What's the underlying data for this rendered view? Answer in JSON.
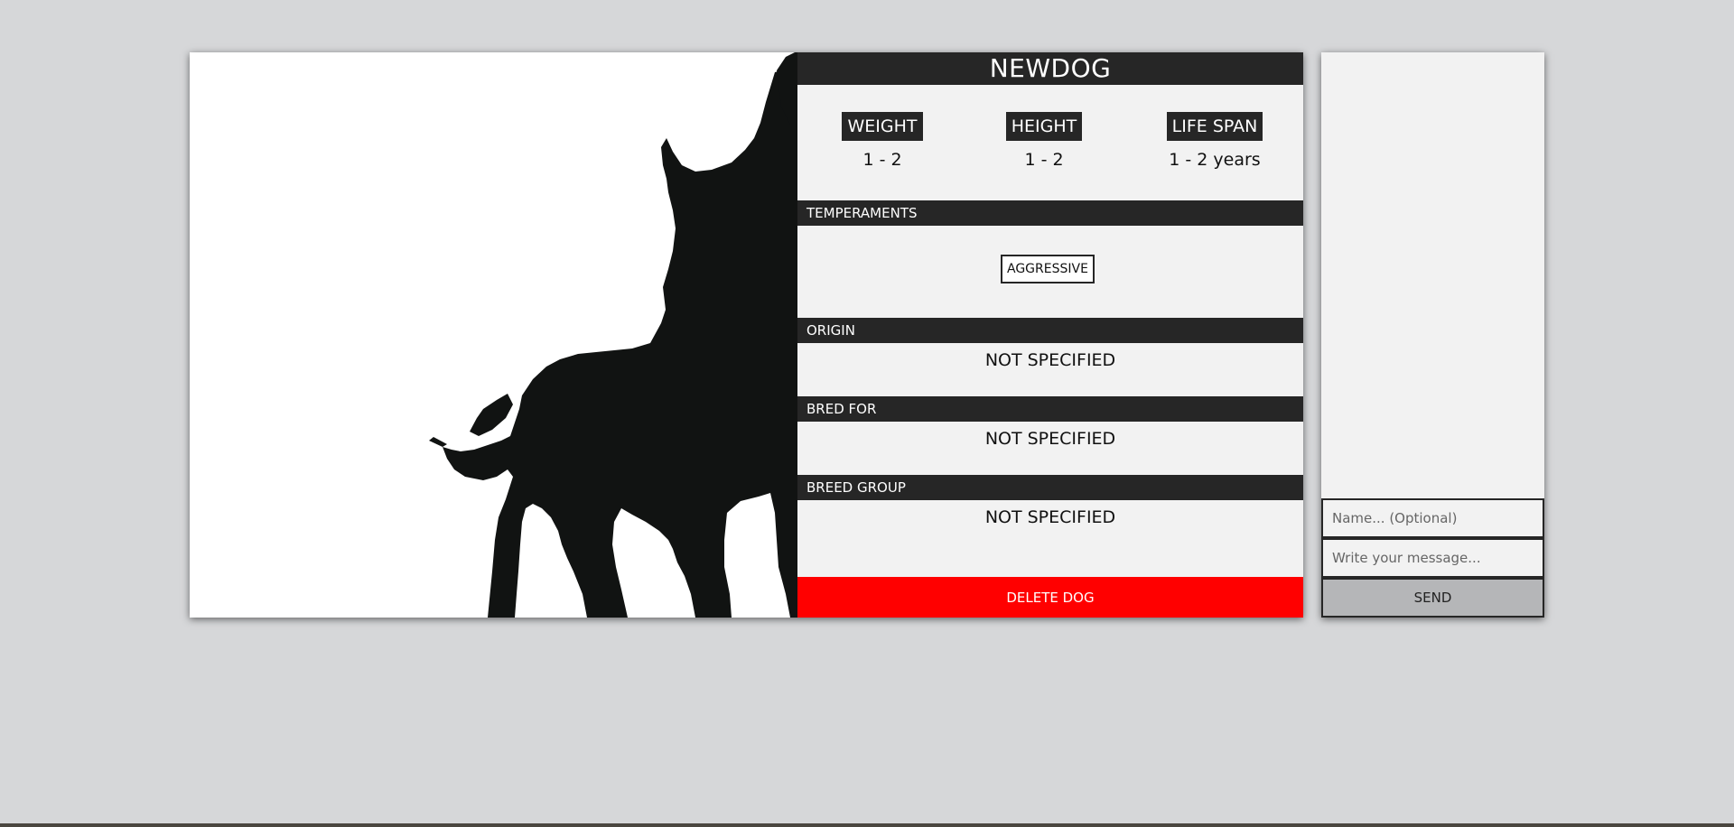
{
  "dog": {
    "name": "NEWDOG",
    "image_icon": "dog-silhouette",
    "stats": [
      {
        "label": "WEIGHT",
        "value": "1 - 2"
      },
      {
        "label": "HEIGHT",
        "value": "1 - 2"
      },
      {
        "label": "LIFE SPAN",
        "value": "1 - 2 years"
      }
    ],
    "temperaments_label": "TEMPERAMENTS",
    "temperaments": [
      "AGGRESSIVE"
    ],
    "origin_label": "ORIGIN",
    "origin_value": "NOT SPECIFIED",
    "bred_for_label": "BRED FOR",
    "bred_for_value": "NOT SPECIFIED",
    "breed_group_label": "BREED GROUP",
    "breed_group_value": "NOT SPECIFIED",
    "delete_label": "DELETE DOG"
  },
  "chat": {
    "name_placeholder": "Name... (Optional)",
    "message_placeholder": "Write your message...",
    "send_label": "SEND"
  },
  "colors": {
    "dark_bar": "#262626",
    "delete_red": "#ff0000",
    "page_bg": "#d6d7d9",
    "panel_bg": "#f2f2f2"
  }
}
